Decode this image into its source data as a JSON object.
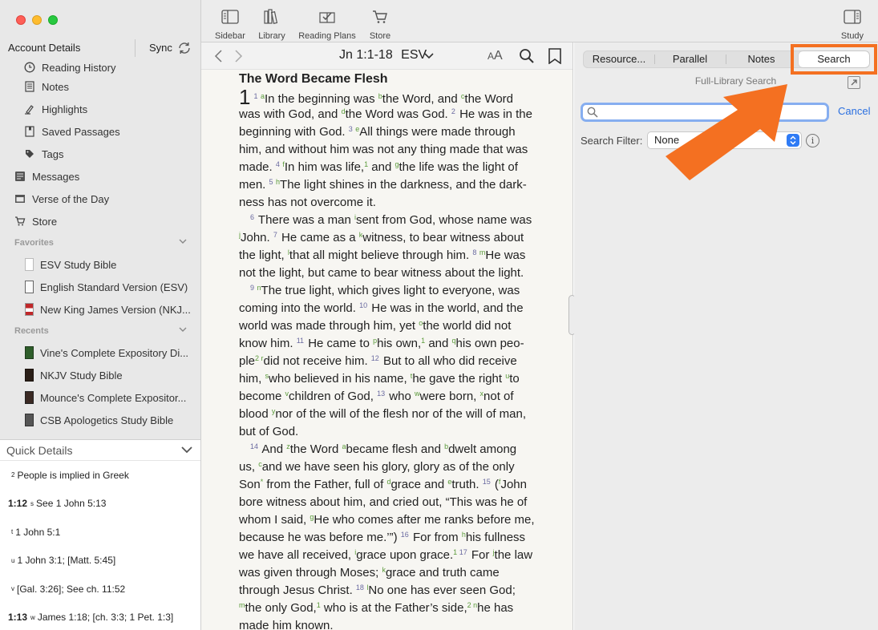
{
  "window": {
    "title_hidden": ""
  },
  "sidebar": {
    "account_label": "Account Details",
    "sync_label": "Sync",
    "items": [
      {
        "label": "Reading History",
        "icon": "clock-icon",
        "level": 2
      },
      {
        "label": "Notes",
        "icon": "note-icon",
        "level": 2
      },
      {
        "label": "Highlights",
        "icon": "highlighter-icon",
        "level": 2
      },
      {
        "label": "Saved Passages",
        "icon": "bookmark-page-icon",
        "level": 2
      },
      {
        "label": "Tags",
        "icon": "tag-icon",
        "level": 2
      },
      {
        "label": "Messages",
        "icon": "messages-icon",
        "level": 1
      },
      {
        "label": "Verse of the Day",
        "icon": "calendar-icon",
        "level": 1
      },
      {
        "label": "Store",
        "icon": "cart-icon",
        "level": 1
      }
    ],
    "favorites_label": "Favorites",
    "favorites": [
      {
        "label": "ESV Study Bible"
      },
      {
        "label": "English Standard Version (ESV)"
      },
      {
        "label": "New King James Version (NKJ..."
      }
    ],
    "recents_label": "Recents",
    "recents": [
      {
        "label": "Vine's Complete Expository Di..."
      },
      {
        "label": "NKJV Study Bible"
      },
      {
        "label": "Mounce's Complete Expositor..."
      },
      {
        "label": "CSB Apologetics Study Bible"
      }
    ]
  },
  "quick_details": {
    "title": "Quick Details",
    "rows": [
      {
        "ref": "",
        "sup": "2",
        "text": "People is implied in Greek"
      },
      {
        "ref": "1:12",
        "sup": "s",
        "text": "See 1 John 5:13"
      },
      {
        "ref": "",
        "sup": "t",
        "text": "1 John 5:1"
      },
      {
        "ref": "",
        "sup": "u",
        "text": "1 John 3:1; [Matt. 5:45]"
      },
      {
        "ref": "",
        "sup": "v",
        "text": "[Gal. 3:26]; See ch. 11:52"
      },
      {
        "ref": "1:13",
        "sup": "w",
        "text": "James 1:18; [ch. 3:3; 1 Pet. 1:3]"
      }
    ]
  },
  "toolbar": {
    "sidebar": "Sidebar",
    "library": "Library",
    "reading_plans": "Reading Plans",
    "store": "Store",
    "study": "Study"
  },
  "reader": {
    "passage": "Jn 1:1-18",
    "version": "ESV",
    "font_size_small": "A",
    "font_size_large": "A",
    "section_title": "The Word Became Flesh",
    "chapter": "1",
    "lines": [
      {
        "indent": false,
        "segs": [
          [
            "c",
            "1"
          ],
          [
            "v",
            "1 "
          ],
          [
            "x",
            "a"
          ],
          [
            "t",
            "In the beginning was "
          ],
          [
            "x",
            "b"
          ],
          [
            "t",
            "the Word, and "
          ],
          [
            "x",
            "c"
          ],
          [
            "t",
            "the Word"
          ]
        ]
      },
      {
        "indent": false,
        "segs": [
          [
            "t",
            "was with God, and "
          ],
          [
            "x",
            "d"
          ],
          [
            "t",
            "the Word was God. "
          ],
          [
            "v",
            "2"
          ],
          [
            "t",
            " He was in the"
          ]
        ]
      },
      {
        "indent": false,
        "segs": [
          [
            "t",
            "beginning with God. "
          ],
          [
            "v",
            "3 "
          ],
          [
            "x",
            "e"
          ],
          [
            "t",
            "All things were made through"
          ]
        ]
      },
      {
        "indent": false,
        "segs": [
          [
            "t",
            "him, and without him was not any thing made that was"
          ]
        ]
      },
      {
        "indent": false,
        "segs": [
          [
            "t",
            "made. "
          ],
          [
            "v",
            "4 "
          ],
          [
            "x",
            "f"
          ],
          [
            "t",
            "In him was life,"
          ],
          [
            "x",
            "1"
          ],
          [
            "t",
            " and "
          ],
          [
            "x",
            "g"
          ],
          [
            "t",
            "the life was the light of"
          ]
        ]
      },
      {
        "indent": false,
        "segs": [
          [
            "t",
            "men. "
          ],
          [
            "v",
            "5 "
          ],
          [
            "x",
            "h"
          ],
          [
            "t",
            "The light shines in the darkness, and the dark-"
          ]
        ]
      },
      {
        "indent": false,
        "segs": [
          [
            "t",
            "ness has not overcome it."
          ]
        ]
      },
      {
        "indent": true,
        "segs": [
          [
            "v",
            "6"
          ],
          [
            "t",
            " There was a man "
          ],
          [
            "x",
            "i"
          ],
          [
            "t",
            "sent from God, whose name was"
          ]
        ]
      },
      {
        "indent": false,
        "segs": [
          [
            "x",
            "j"
          ],
          [
            "t",
            "John. "
          ],
          [
            "v",
            "7"
          ],
          [
            "t",
            " He came as a "
          ],
          [
            "x",
            "k"
          ],
          [
            "t",
            "witness, to bear witness about"
          ]
        ]
      },
      {
        "indent": false,
        "segs": [
          [
            "t",
            "the light, "
          ],
          [
            "x",
            "l"
          ],
          [
            "t",
            "that all might believe through him. "
          ],
          [
            "v",
            "8 "
          ],
          [
            "x",
            "m"
          ],
          [
            "t",
            "He was"
          ]
        ]
      },
      {
        "indent": false,
        "segs": [
          [
            "t",
            "not the light, but came to bear witness about the light."
          ]
        ]
      },
      {
        "indent": true,
        "segs": [
          [
            "v",
            "9 "
          ],
          [
            "x",
            "n"
          ],
          [
            "t",
            "The true light, which gives light to everyone, was"
          ]
        ]
      },
      {
        "indent": false,
        "segs": [
          [
            "t",
            "coming into the world. "
          ],
          [
            "v",
            "10"
          ],
          [
            "t",
            " He was in the world, and the"
          ]
        ]
      },
      {
        "indent": false,
        "segs": [
          [
            "t",
            "world was made through him, yet "
          ],
          [
            "x",
            "o"
          ],
          [
            "t",
            "the world did not"
          ]
        ]
      },
      {
        "indent": false,
        "segs": [
          [
            "t",
            "know him. "
          ],
          [
            "v",
            "11"
          ],
          [
            "t",
            " He came to "
          ],
          [
            "x",
            "p"
          ],
          [
            "t",
            "his own,"
          ],
          [
            "x",
            "1"
          ],
          [
            "t",
            " and "
          ],
          [
            "x",
            "q"
          ],
          [
            "t",
            "his own peo-"
          ]
        ]
      },
      {
        "indent": false,
        "segs": [
          [
            "t",
            "ple"
          ],
          [
            "x",
            "2 r"
          ],
          [
            "t",
            "did not receive him. "
          ],
          [
            "v",
            "12"
          ],
          [
            "t",
            " But to all who did receive"
          ]
        ]
      },
      {
        "indent": false,
        "segs": [
          [
            "t",
            "him, "
          ],
          [
            "x",
            "s"
          ],
          [
            "t",
            "who believed in his name, "
          ],
          [
            "x",
            "t"
          ],
          [
            "t",
            "he gave the right "
          ],
          [
            "x",
            "u"
          ],
          [
            "t",
            "to"
          ]
        ]
      },
      {
        "indent": false,
        "segs": [
          [
            "t",
            "become "
          ],
          [
            "x",
            "v"
          ],
          [
            "t",
            "children of God, "
          ],
          [
            "v",
            "13"
          ],
          [
            "t",
            " who "
          ],
          [
            "x",
            "w"
          ],
          [
            "t",
            "were born, "
          ],
          [
            "x",
            "x"
          ],
          [
            "t",
            "not of"
          ]
        ]
      },
      {
        "indent": false,
        "segs": [
          [
            "t",
            "blood "
          ],
          [
            "x",
            "y"
          ],
          [
            "t",
            "nor of the will of the flesh nor of the will of man,"
          ]
        ]
      },
      {
        "indent": false,
        "segs": [
          [
            "t",
            "but of God."
          ]
        ]
      },
      {
        "indent": true,
        "segs": [
          [
            "v",
            "14"
          ],
          [
            "t",
            " And "
          ],
          [
            "x",
            "z"
          ],
          [
            "t",
            "the Word "
          ],
          [
            "x",
            "a"
          ],
          [
            "t",
            "became flesh and "
          ],
          [
            "x",
            "b"
          ],
          [
            "t",
            "dwelt among"
          ]
        ]
      },
      {
        "indent": false,
        "segs": [
          [
            "t",
            "us, "
          ],
          [
            "x",
            "c"
          ],
          [
            "t",
            "and we have seen his glory, glory as of the only"
          ]
        ]
      },
      {
        "indent": false,
        "segs": [
          [
            "t",
            "Son"
          ],
          [
            "x",
            "*"
          ],
          [
            "t",
            " from the Father, full of "
          ],
          [
            "x",
            "d"
          ],
          [
            "t",
            "grace and "
          ],
          [
            "x",
            "e"
          ],
          [
            "t",
            "truth. "
          ],
          [
            "v",
            "15"
          ],
          [
            "t",
            " ("
          ],
          [
            "x",
            "f"
          ],
          [
            "t",
            "John"
          ]
        ]
      },
      {
        "indent": false,
        "segs": [
          [
            "t",
            "bore witness about him, and cried out, “This was he of"
          ]
        ]
      },
      {
        "indent": false,
        "segs": [
          [
            "t",
            "whom I said, "
          ],
          [
            "x",
            "g"
          ],
          [
            "t",
            "He who comes after me ranks before me,"
          ]
        ]
      },
      {
        "indent": false,
        "segs": [
          [
            "t",
            "because he was before me.’”) "
          ],
          [
            "v",
            "16"
          ],
          [
            "t",
            " For from "
          ],
          [
            "x",
            "h"
          ],
          [
            "t",
            "his fullness"
          ]
        ]
      },
      {
        "indent": false,
        "segs": [
          [
            "t",
            "we have all received, "
          ],
          [
            "x",
            "i"
          ],
          [
            "t",
            "grace upon grace."
          ],
          [
            "x",
            "1"
          ],
          [
            "v",
            " 17"
          ],
          [
            "t",
            " For "
          ],
          [
            "x",
            "j"
          ],
          [
            "t",
            "the law"
          ]
        ]
      },
      {
        "indent": false,
        "segs": [
          [
            "t",
            "was given through Moses; "
          ],
          [
            "x",
            "k"
          ],
          [
            "t",
            "grace and truth came"
          ]
        ]
      },
      {
        "indent": false,
        "segs": [
          [
            "t",
            "through Jesus Christ. "
          ],
          [
            "v",
            "18 "
          ],
          [
            "x",
            "l"
          ],
          [
            "t",
            "No one has ever seen God;"
          ]
        ]
      },
      {
        "indent": false,
        "segs": [
          [
            "x",
            "m"
          ],
          [
            "t",
            "the only God,"
          ],
          [
            "x",
            "1"
          ],
          [
            "t",
            " who is at the Father’s side,"
          ],
          [
            "x",
            "2 n"
          ],
          [
            "t",
            "he has"
          ]
        ]
      },
      {
        "indent": false,
        "segs": [
          [
            "t",
            "made him known."
          ]
        ]
      }
    ]
  },
  "right_panel": {
    "tabs": [
      "Resource...",
      "Parallel",
      "Notes",
      "Search"
    ],
    "active_tab": "Search",
    "heading": "Full-Library Search",
    "search_value": "",
    "cancel": "Cancel",
    "filter_label": "Search Filter:",
    "filter_value": "None",
    "highlight_color": "#f47021"
  }
}
